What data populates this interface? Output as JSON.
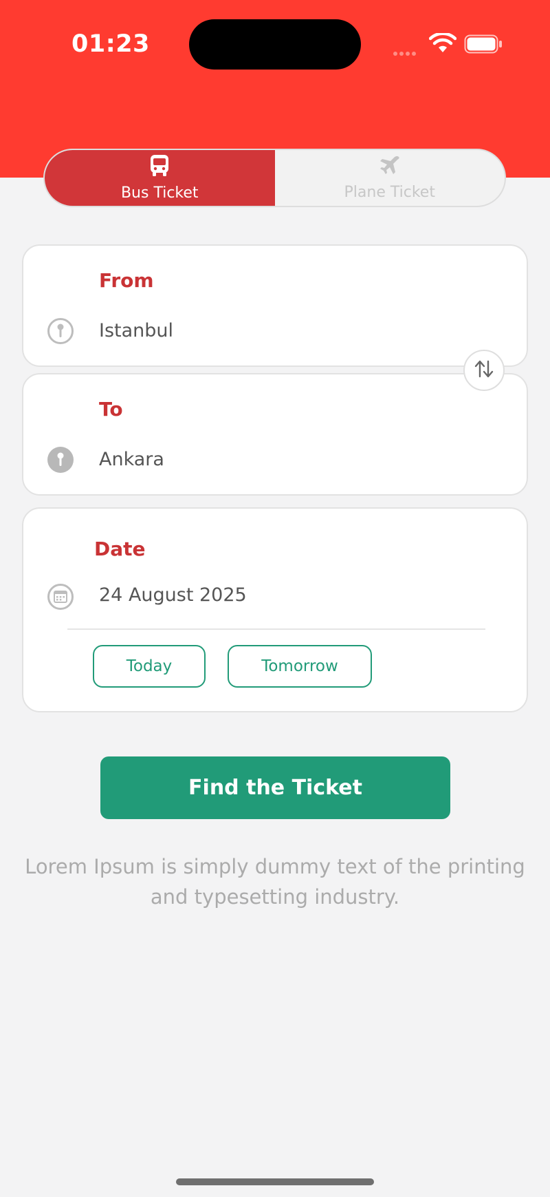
{
  "status_bar": {
    "time": "01:23"
  },
  "segment": {
    "bus_label": "Bus Ticket",
    "plane_label": "Plane Ticket",
    "selected": "bus"
  },
  "from": {
    "title": "From",
    "value": "Istanbul"
  },
  "to": {
    "title": "To",
    "value": "Ankara"
  },
  "date": {
    "title": "Date",
    "value": "24 August 2025",
    "today_label": "Today",
    "tomorrow_label": "Tomorrow"
  },
  "find_button_label": "Find the Ticket",
  "description": "Lorem Ipsum is simply dummy text of the printing and typesetting industry.",
  "colors": {
    "header": "#ff3b30",
    "selected_segment": "#d13639",
    "title_red": "#c93335",
    "primary_green": "#219b78"
  },
  "icons": [
    "bus-icon",
    "plane-icon",
    "location-pin-icon",
    "swap-icon",
    "calendar-icon",
    "wifi-icon",
    "battery-icon"
  ]
}
